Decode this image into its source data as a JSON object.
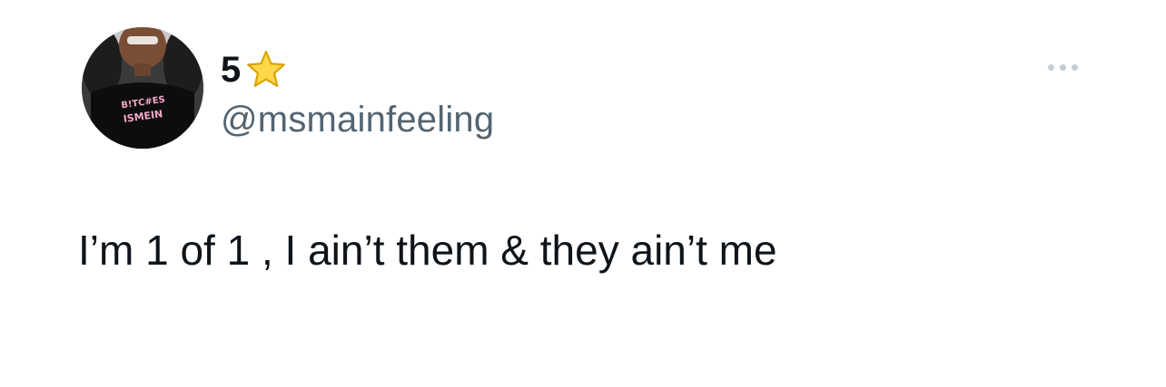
{
  "author": {
    "display_name": "5",
    "badge_icon": "star-icon",
    "handle": "@msmainfeeling",
    "avatar_shirt_text": [
      "B!TC#ES",
      "ISMEIN"
    ]
  },
  "menu": {
    "icon": "more-horizontal-icon"
  },
  "tweet": {
    "text": "I’m 1 of 1 , I ain’t them & they ain’t me"
  },
  "colors": {
    "text_primary": "#0f1419",
    "text_secondary": "#536471",
    "menu_dots": "#c4cdd4",
    "star_fill": "#ffd84a",
    "star_stroke": "#d9a400"
  }
}
